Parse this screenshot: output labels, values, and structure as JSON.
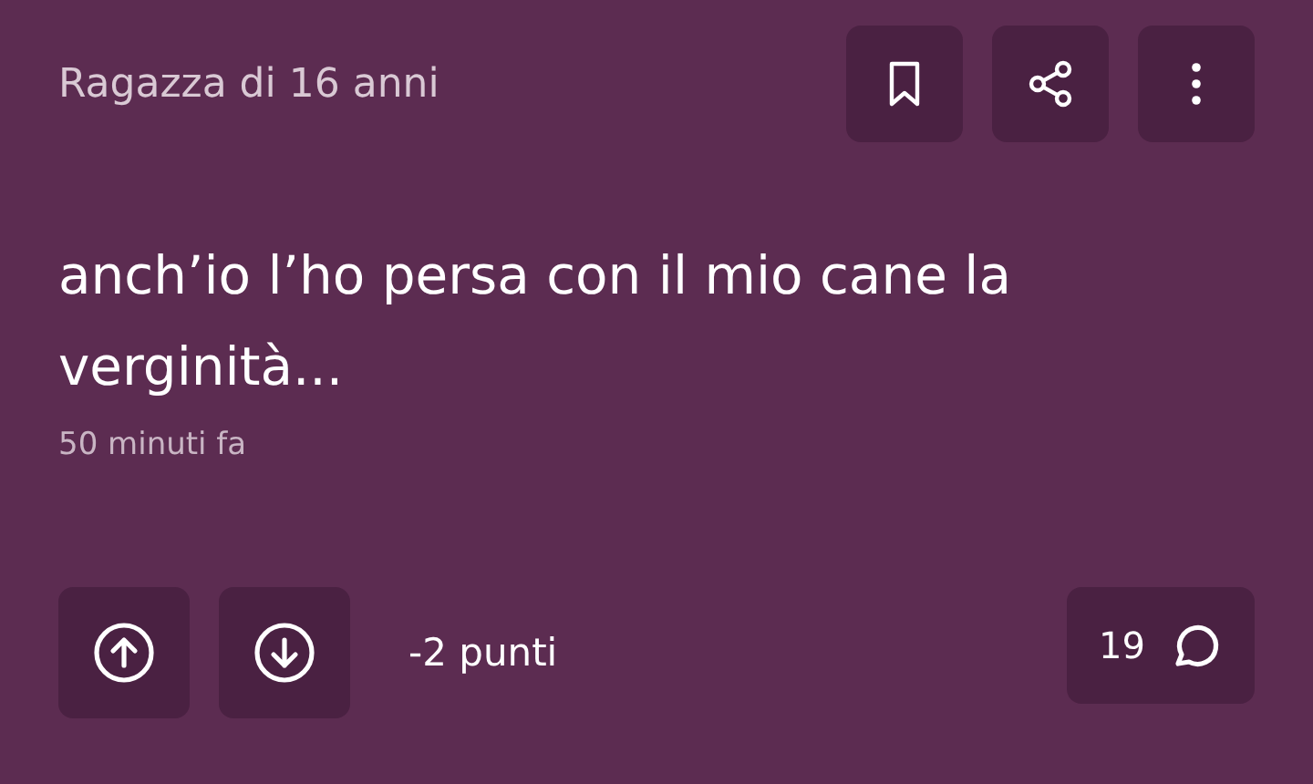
{
  "author": "Ragazza di 16 anni",
  "post": {
    "text": "anch’io l’ho persa con il mio cane la verginità...",
    "time": "50 minuti fa"
  },
  "score": "-2 punti",
  "comments": "19"
}
